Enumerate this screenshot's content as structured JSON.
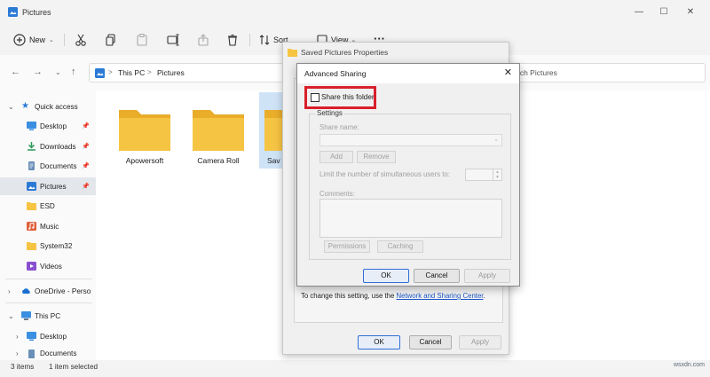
{
  "window": {
    "title": "Pictures",
    "minimize": "—",
    "maximize": "☐",
    "close": "✕"
  },
  "toolbar": {
    "new_label": "New",
    "sort_label": "Sort",
    "view_label": "View",
    "more_label": "···"
  },
  "address": {
    "path": [
      "This PC",
      "Pictures"
    ],
    "separator": ">",
    "search_placeholder": "rch Pictures"
  },
  "sidebar": {
    "quick_access": "Quick access",
    "items": [
      {
        "label": "Desktop",
        "pinned": true
      },
      {
        "label": "Downloads",
        "pinned": true
      },
      {
        "label": "Documents",
        "pinned": true
      },
      {
        "label": "Pictures",
        "pinned": true,
        "selected": true
      },
      {
        "label": "ESD"
      },
      {
        "label": "Music"
      },
      {
        "label": "System32"
      },
      {
        "label": "Videos"
      }
    ],
    "onedrive": "OneDrive - Perso",
    "this_pc": "This PC",
    "this_pc_items": [
      {
        "label": "Desktop"
      },
      {
        "label": "Documents"
      }
    ]
  },
  "folders": [
    {
      "label": "Apowersoft"
    },
    {
      "label": "Camera Roll"
    },
    {
      "label": "Sav"
    }
  ],
  "status": {
    "items": "3 items",
    "selected": "1 item selected"
  },
  "watermark": "wsxdn.com",
  "properties_dialog": {
    "title": "Saved Pictures Properties",
    "info_text": "To change this setting, use the ",
    "info_link": "Network and Sharing Center",
    "info_end": ".",
    "ok": "OK",
    "cancel": "Cancel",
    "apply": "Apply"
  },
  "advanced_sharing": {
    "title": "Advanced Sharing",
    "close": "✕",
    "share_checkbox_label": "Share this folder",
    "share_checked": false,
    "settings_legend": "Settings",
    "share_name_label": "Share name:",
    "add": "Add",
    "remove": "Remove",
    "limit_label": "Limit the number of simultaneous users to:",
    "comments_label": "Comments:",
    "permissions": "Permissions",
    "caching": "Caching",
    "ok": "OK",
    "cancel": "Cancel",
    "apply": "Apply"
  },
  "colors": {
    "highlight": "#d9202a",
    "folder": "#f6c443",
    "link": "#1a56c6",
    "accent": "#2f6fd6"
  }
}
